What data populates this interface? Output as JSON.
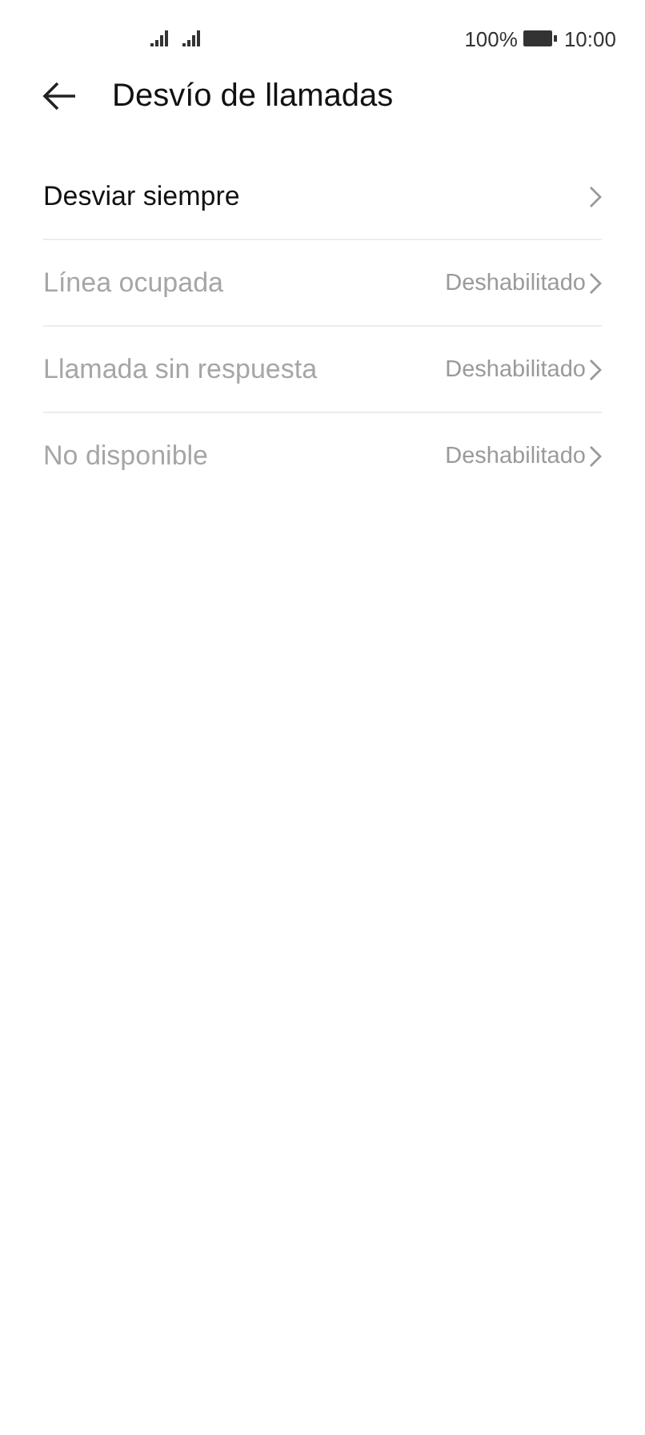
{
  "status_bar": {
    "battery": "100%",
    "time": "10:00"
  },
  "header": {
    "title": "Desvío de llamadas"
  },
  "items": [
    {
      "label": "Desviar siempre",
      "disabled": false
    },
    {
      "label": "Línea ocupada",
      "value": "Deshabilitado",
      "disabled": true
    },
    {
      "label": "Llamada sin respuesta",
      "value": "Deshabilitado",
      "disabled": true
    },
    {
      "label": "No disponible",
      "value": "Deshabilitado",
      "disabled": true
    }
  ]
}
